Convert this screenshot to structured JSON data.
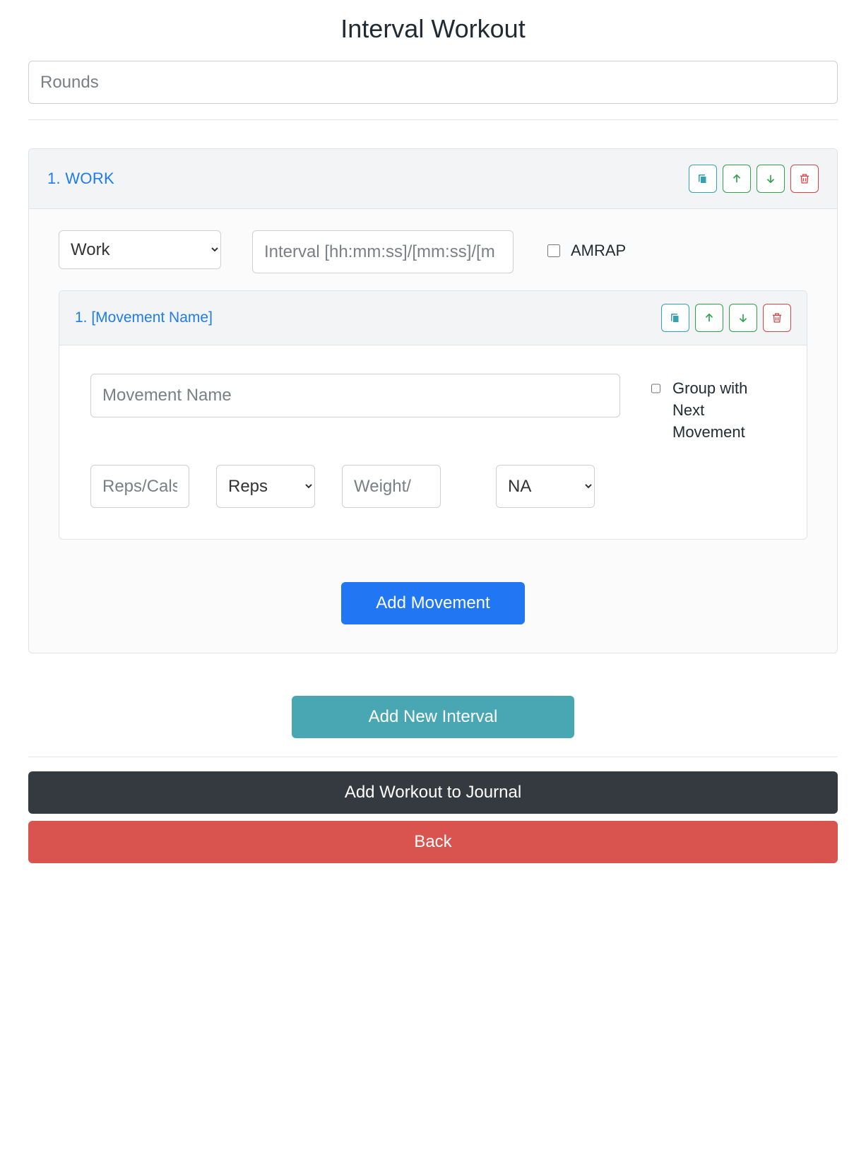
{
  "title": "Interval Workout",
  "rounds_placeholder": "Rounds",
  "interval": {
    "header": "1. WORK",
    "type_selected": "Work",
    "duration_placeholder": "Interval [hh:mm:ss]/[mm:ss]/[m",
    "amrap_label": "AMRAP",
    "movement": {
      "header": "1. [Movement Name]",
      "name_placeholder": "Movement Name",
      "group_label": "Group with Next Movement",
      "reps_placeholder": "Reps/Cals",
      "unit_selected": "Reps",
      "weight_placeholder": "Weight/",
      "weight_unit_selected": "NA"
    },
    "add_movement_label": "Add Movement"
  },
  "add_interval_label": "Add New Interval",
  "add_journal_label": "Add Workout to Journal",
  "back_label": "Back"
}
